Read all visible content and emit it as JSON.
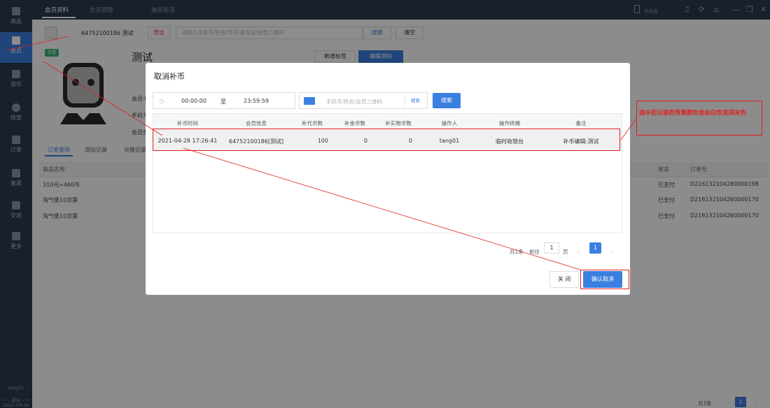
{
  "sidebar": {
    "items": [
      {
        "label": "商品",
        "icon": "grid-icon"
      },
      {
        "label": "会员",
        "icon": "vip-card-icon"
      },
      {
        "label": "游乐",
        "icon": "shield-icon"
      },
      {
        "label": "体育",
        "icon": "ball-icon"
      },
      {
        "label": "订单",
        "icon": "order-icon"
      },
      {
        "label": "套票",
        "icon": "ticket-icon"
      },
      {
        "label": "交班",
        "icon": "handover-icon"
      },
      {
        "label": "更多",
        "icon": "apps-icon"
      }
    ],
    "user": "tang01",
    "role": "一 - 前台 - 一",
    "date": "2021-04-26"
  },
  "topbar": {
    "tabs": [
      "会员资料",
      "会员调整",
      "抽奖秘语"
    ],
    "device_status": "未连接",
    "icons": [
      "bell-icon",
      "refresh-icon",
      "lock-icon",
      "minimize-icon",
      "restore-icon",
      "close-icon"
    ]
  },
  "member": {
    "id_label": "64752100186 测试",
    "logout": "登出",
    "search_placeholder": "请输入手机号/姓名/卡号/身份证/会员二维码",
    "search_btn": "搜索",
    "clear_btn": "清空",
    "status_badge": "正常",
    "name": "测试",
    "tag_btn": "新增标签",
    "edit_btn": "编辑资料",
    "field1": "会员卡",
    "field2": "手机号",
    "field3": "会员生"
  },
  "subtabs": [
    "订单查询",
    "游玩记录",
    "兑换记录"
  ],
  "orders": {
    "headers": {
      "name": "商品名称",
      "status": "状态",
      "order_no": "订单号"
    },
    "rows": [
      {
        "name": "310元=460币",
        "status": "已支付",
        "order_no": "D216132104280000198"
      },
      {
        "name": "淘气堡10次票",
        "status": "已支付",
        "order_no": "D216132104260000170"
      },
      {
        "name": "淘气堡10次票",
        "status": "已支付",
        "order_no": "D216132104260000170"
      }
    ],
    "footer_total": "共3条"
  },
  "modal": {
    "title": "取消补币",
    "time_start": "00:00:00",
    "time_sep": "至",
    "time_end": "23:59:59",
    "search_placeholder": "手机号/姓名/会员二维码",
    "kb_btn": "搜索",
    "search_btn": "搜索",
    "headers": [
      "补币时间",
      "会员信息",
      "补代币数",
      "补金币数",
      "补实物币数",
      "操作人",
      "操作终端",
      "备注"
    ],
    "row": {
      "time": "2021-04-28 17:26:41",
      "member": "64752100186[测试]",
      "token": "100",
      "gold": "0",
      "physical": "0",
      "operator": "tang01",
      "terminal": "临时收银台",
      "remark": "补币编辑:测试"
    },
    "pager": {
      "total": "共1条",
      "goto": "前往",
      "page_input": "1",
      "page_unit": "页",
      "current": "1"
    },
    "close_btn": "关 闭",
    "confirm_btn": "确认取消"
  },
  "annotation": "选中后记录的背景颜色会由白色变成灰色",
  "colors": {
    "accent": "#3b7fe0",
    "sidebar": "#2c3a52",
    "annotation": "#e02020"
  }
}
